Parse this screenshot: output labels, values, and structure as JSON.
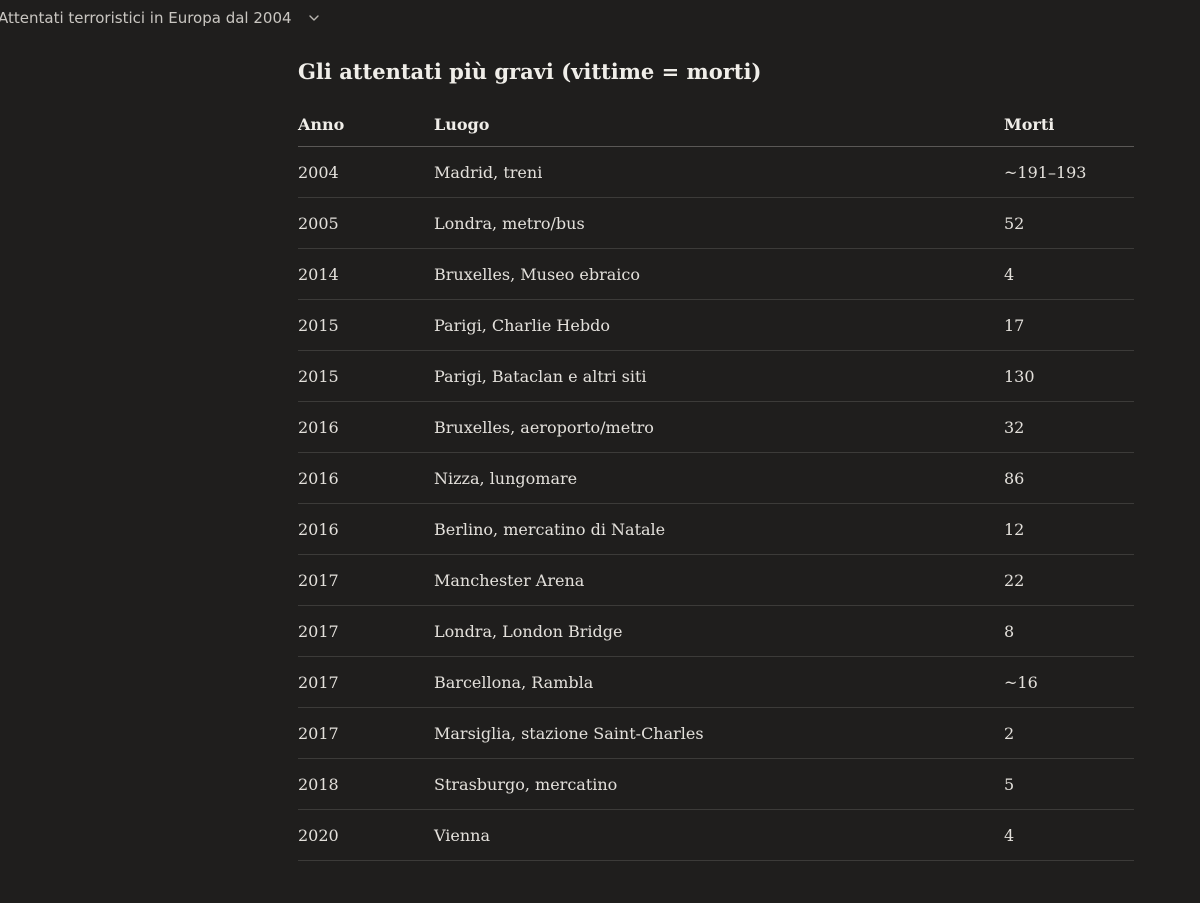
{
  "header": {
    "title": "Attentati terroristici in Europa dal 2004",
    "icon": "chevron-down-icon"
  },
  "main": {
    "heading": "Gli attentati più gravi (vittime = morti)",
    "table": {
      "columns": [
        "Anno",
        "Luogo",
        "Morti"
      ],
      "rows": [
        [
          "2004",
          "Madrid, treni",
          "~191–193"
        ],
        [
          "2005",
          "Londra, metro/bus",
          "52"
        ],
        [
          "2014",
          "Bruxelles, Museo ebraico",
          "4"
        ],
        [
          "2015",
          "Parigi, Charlie Hebdo",
          "17"
        ],
        [
          "2015",
          "Parigi, Bataclan e altri siti",
          "130"
        ],
        [
          "2016",
          "Bruxelles, aeroporto/metro",
          "32"
        ],
        [
          "2016",
          "Nizza, lungomare",
          "86"
        ],
        [
          "2016",
          "Berlino, mercatino di Natale",
          "12"
        ],
        [
          "2017",
          "Manchester Arena",
          "22"
        ],
        [
          "2017",
          "Londra, London Bridge",
          "8"
        ],
        [
          "2017",
          "Barcellona, Rambla",
          "~16"
        ],
        [
          "2017",
          "Marsiglia, stazione Saint-Charles",
          "2"
        ],
        [
          "2018",
          "Strasburgo, mercatino",
          "5"
        ],
        [
          "2020",
          "Vienna",
          "4"
        ]
      ]
    }
  }
}
